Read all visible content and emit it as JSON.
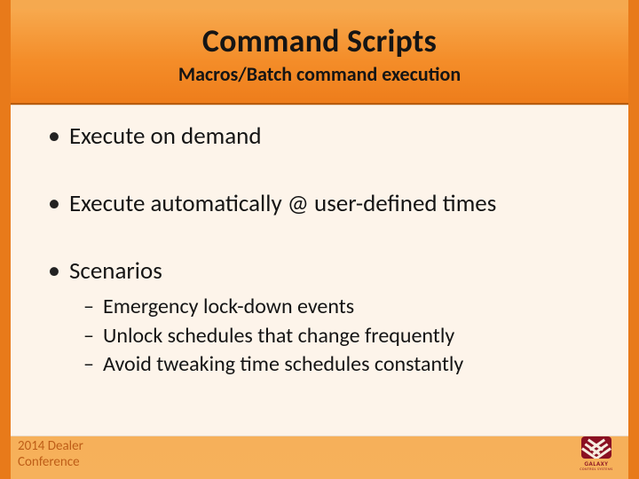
{
  "title": "Command Scripts",
  "subtitle": "Macros/Batch command execution",
  "bullets": {
    "b1": "Execute on demand",
    "b2": "Execute automatically @ user-defined times",
    "b3": "Scenarios",
    "sub": {
      "s1": "Emergency lock-down events",
      "s2": "Unlock schedules that change frequently",
      "s3": "Avoid tweaking time schedules constantly"
    }
  },
  "footer": {
    "line1": "2014 Dealer",
    "line2": "Conference"
  },
  "logo": {
    "name": "GALAXY",
    "sub": "CONTROL SYSTEMS"
  }
}
